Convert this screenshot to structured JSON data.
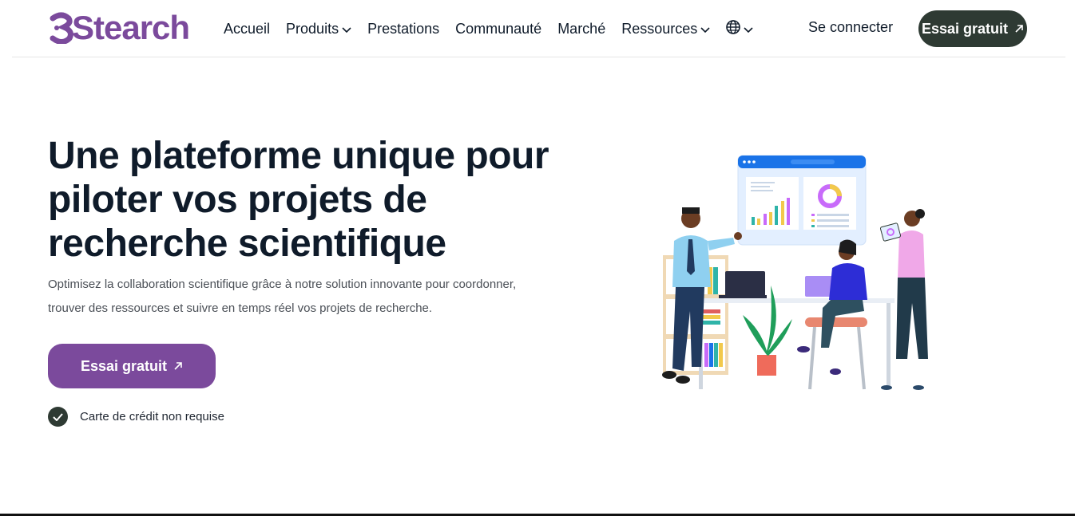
{
  "brand": {
    "name": "Stearch",
    "color": "#7b4a9c"
  },
  "nav": {
    "items": [
      {
        "label": "Accueil",
        "dropdown": false
      },
      {
        "label": "Produits",
        "dropdown": true
      },
      {
        "label": "Prestations",
        "dropdown": false
      },
      {
        "label": "Communauté",
        "dropdown": false
      },
      {
        "label": "Marché",
        "dropdown": false
      },
      {
        "label": "Ressources",
        "dropdown": true
      }
    ],
    "language_icon": "globe-icon",
    "login_label": "Se connecter",
    "trial_label": "Essai gratuit"
  },
  "hero": {
    "title": "Une plateforme unique pour piloter vos projets de recherche scientifique",
    "subtitle": "Optimisez la collaboration scientifique grâce à notre solution innovante pour coordonner, trouver des ressources et suivre en temps réel vos projets de recherche.",
    "cta_label": "Essai gratuit",
    "note": "Carte de crédit non requise"
  },
  "colors": {
    "accent": "#7b4a9c",
    "dark_button": "#2e3a33",
    "text": "#0f1b2a"
  }
}
